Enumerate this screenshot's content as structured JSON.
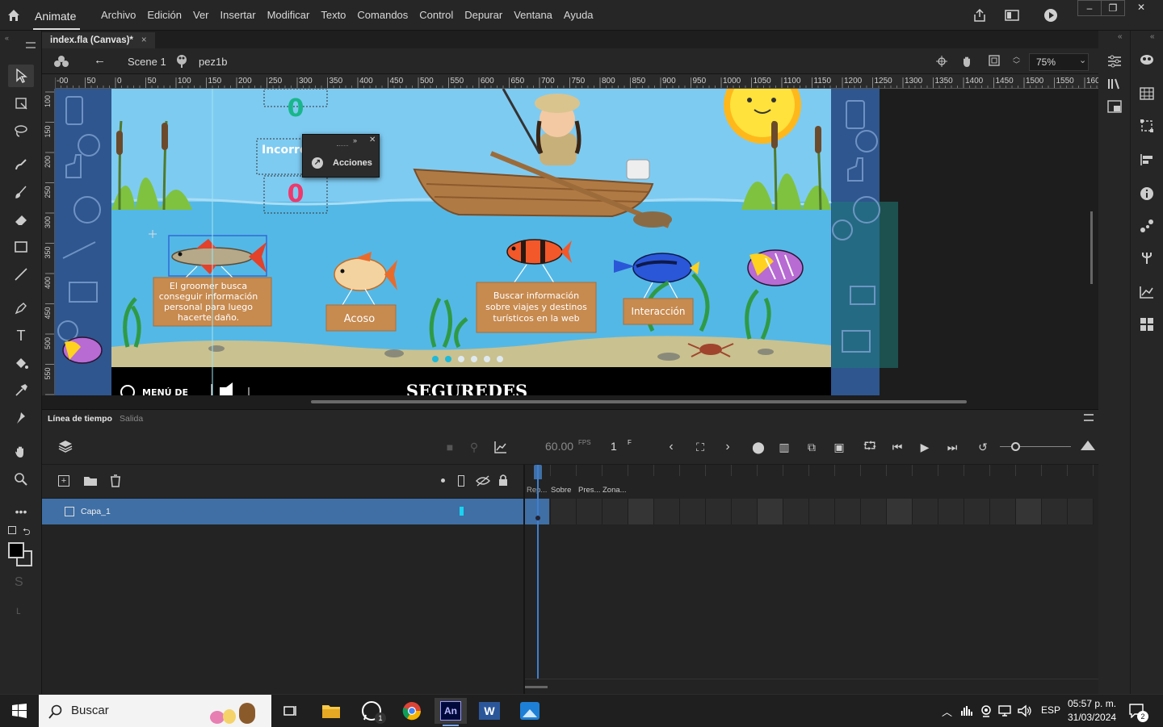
{
  "app": {
    "name": "Animate"
  },
  "menu": [
    "Archivo",
    "Edición",
    "Ver",
    "Insertar",
    "Modificar",
    "Texto",
    "Comandos",
    "Control",
    "Depurar",
    "Ventana",
    "Ayuda"
  ],
  "doc_tab": {
    "title": "index.fla (Canvas)*",
    "close": "×"
  },
  "editbar": {
    "scene": "Scene 1",
    "symbol": "pez1b",
    "zoom": "75%"
  },
  "ruler_h": [
    "-00",
    "50",
    "0",
    "50",
    "100",
    "150",
    "200",
    "250",
    "300",
    "350",
    "400",
    "450",
    "500",
    "550",
    "600",
    "650",
    "700",
    "750",
    "800",
    "850",
    "900",
    "950",
    "1000",
    "1050",
    "1100",
    "1150",
    "1200",
    "1250",
    "1300",
    "1350",
    "1400",
    "1450",
    "1500",
    "1550",
    "160"
  ],
  "ruler_v": [
    "100",
    "150",
    "200",
    "250",
    "300",
    "350",
    "400",
    "450",
    "500",
    "550",
    "600"
  ],
  "stage": {
    "counter_correct": "0",
    "incorrect_label": "Incorre",
    "counter_incorrect": "0",
    "actions_panel": {
      "label": "Acciones"
    },
    "signs": [
      "El groomer busca conseguir información personal para luego hacerte daño.",
      "Acoso",
      "Buscar información sobre viajes y destinos turísticos en la web",
      "Interacción"
    ],
    "footer_menu": "MENÚ DE",
    "footer_brand": "SEGUREDES"
  },
  "timeline": {
    "tabs": [
      "Línea de tiempo",
      "Salida"
    ],
    "fps": "60.00",
    "fps_unit": "FPS",
    "frame": "1",
    "frame_unit": "F",
    "frame_labels": [
      "Rep...",
      "Sobre",
      "Pres...",
      "Zona..."
    ],
    "layers": [
      {
        "name": "Capa_1"
      }
    ]
  },
  "taskbar": {
    "search_placeholder": "Buscar",
    "lang": "ESP",
    "time": "05:57 p. m.",
    "date": "31/03/2024",
    "whatsapp_badge": "1",
    "notif_count": "2"
  },
  "colors": {
    "accent": "#3f6fa5",
    "layer_marker": "#19d3f0",
    "sea": "#54b8e6",
    "sky": "#7ecbf2",
    "sand": "#c9c18f",
    "wood": "#c78a4f"
  }
}
